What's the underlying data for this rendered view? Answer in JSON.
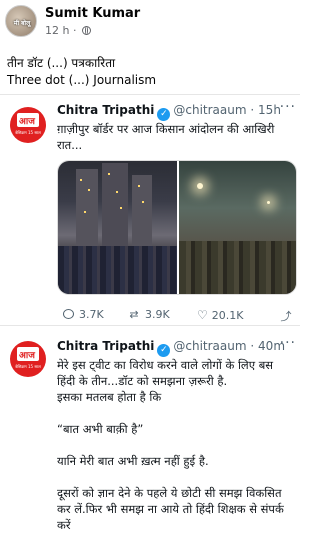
{
  "post": {
    "author": "Sumit Kumar",
    "time": "12 h",
    "meta_separator": "·",
    "avatar_text": "मी बोलू",
    "line1": "तीन डॉट (...) पत्रकारिता",
    "line2": "Three dot (...) Journalism"
  },
  "tweets": [
    {
      "avatar_brand": "आज तक",
      "avatar_sub": "बेसिक्रम 15 साल",
      "name": "Chitra Tripathi",
      "verified_mark": "✓",
      "handle": "@chitraaum",
      "sep": "·",
      "time": "15h",
      "text_lines": [
        "ग़ाज़ीपुर बॉर्डर पर आज किसान आंदोलन की आखिरी",
        "रात..."
      ],
      "replies": "3.7K",
      "retweets": "3.9K",
      "likes": "20.1K"
    },
    {
      "avatar_brand": "आज तक",
      "avatar_sub": "बेसिक्रम 15 साल",
      "name": "Chitra Tripathi",
      "verified_mark": "✓",
      "handle": "@chitraaum",
      "sep": "·",
      "time": "40m",
      "text_lines": [
        "मेरे इस ट्वीट का विरोध करने वाले लोगों के लिए बस",
        "हिंदी के तीन...डॉट को समझना ज़रूरी है.",
        "इसका मतलब होता है कि",
        "",
        "“बात अभी बाक़ी है”",
        "",
        "यानि मेरी बात अभी ख़त्म नहीं हुई है.",
        "",
        "दूसरों को ज्ञान देने के पहले ये छोटी सी समझ विकसित",
        "कर लें.फिर भी समझ ना आये तो हिंदी शिक्षक से संपर्क",
        "करें"
      ]
    }
  ],
  "icons": {
    "more": "···",
    "retweet": "⇄",
    "heart": "♡",
    "share": "⤴"
  }
}
